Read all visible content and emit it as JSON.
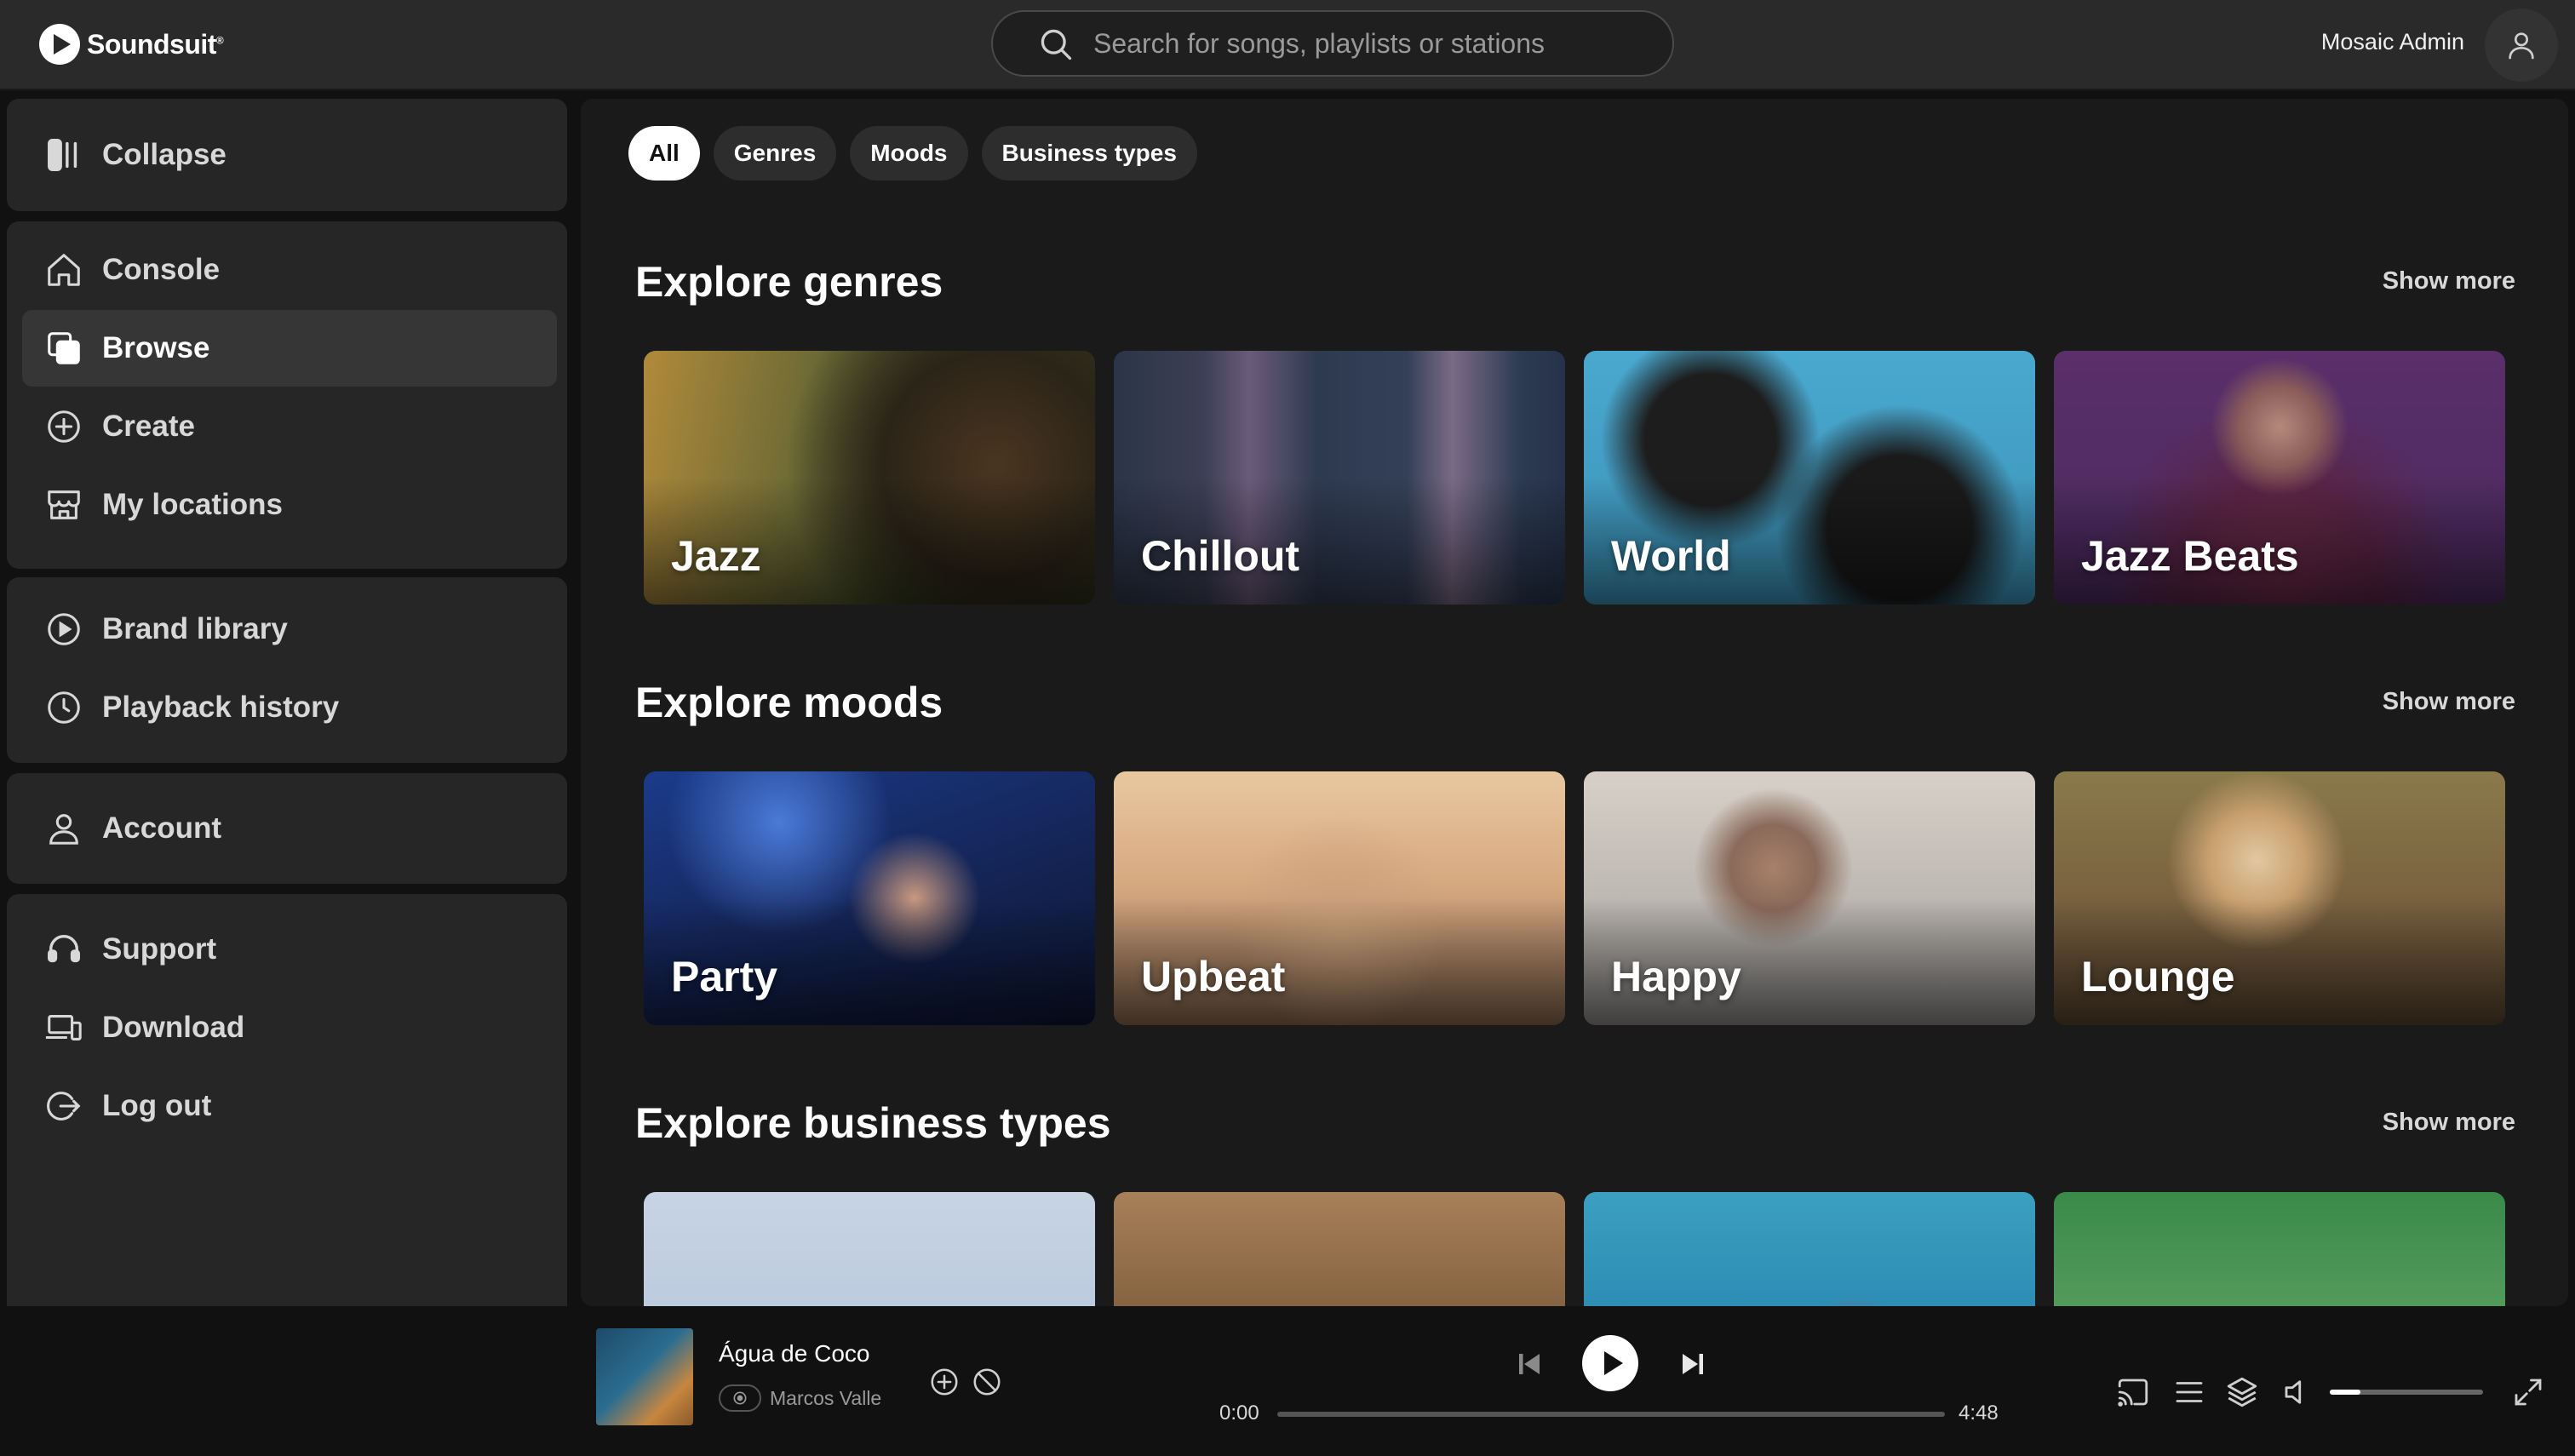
{
  "app": {
    "brand": "Soundsuit",
    "brand_mark": "®"
  },
  "search": {
    "placeholder": "Search for songs, playlists or stations",
    "value": ""
  },
  "user": {
    "name": "Mosaic Admin",
    "icon": "user-icon"
  },
  "sidebar": {
    "collapse_label": "Collapse",
    "items": [
      {
        "label": "Console",
        "icon": "home-icon"
      },
      {
        "label": "Browse",
        "icon": "browse-icon",
        "active": true
      },
      {
        "label": "Create",
        "icon": "plus-circle-icon"
      },
      {
        "label": "My locations",
        "icon": "store-icon"
      },
      {
        "label": "Brand library",
        "icon": "play-circle-icon"
      },
      {
        "label": "Playback history",
        "icon": "clock-icon"
      },
      {
        "label": "Account",
        "icon": "user-icon"
      },
      {
        "label": "Support",
        "icon": "headset-icon"
      },
      {
        "label": "Download",
        "icon": "devices-icon"
      },
      {
        "label": "Log out",
        "icon": "logout-icon"
      }
    ]
  },
  "filters": {
    "chips": [
      "All",
      "Genres",
      "Moods",
      "Business types"
    ],
    "active": "All"
  },
  "sections": [
    {
      "title": "Explore genres",
      "show_more": "Show more",
      "cards": [
        "Jazz",
        "Chillout",
        "World",
        "Jazz Beats"
      ]
    },
    {
      "title": "Explore moods",
      "show_more": "Show more",
      "cards": [
        "Party",
        "Upbeat",
        "Happy",
        "Lounge"
      ]
    },
    {
      "title": "Explore business types",
      "show_more": "Show more",
      "cards": [
        "",
        "",
        "",
        ""
      ]
    }
  ],
  "player": {
    "track_title": "Água de Coco",
    "artist": "Marcos Valle",
    "current_time": "0:00",
    "duration": "4:48",
    "progress": 0,
    "volume": 0.2
  },
  "colors": {
    "background": "#111111",
    "panel": "#1a1a1a",
    "sidebar": "#262626",
    "accent": "#ffffff"
  }
}
